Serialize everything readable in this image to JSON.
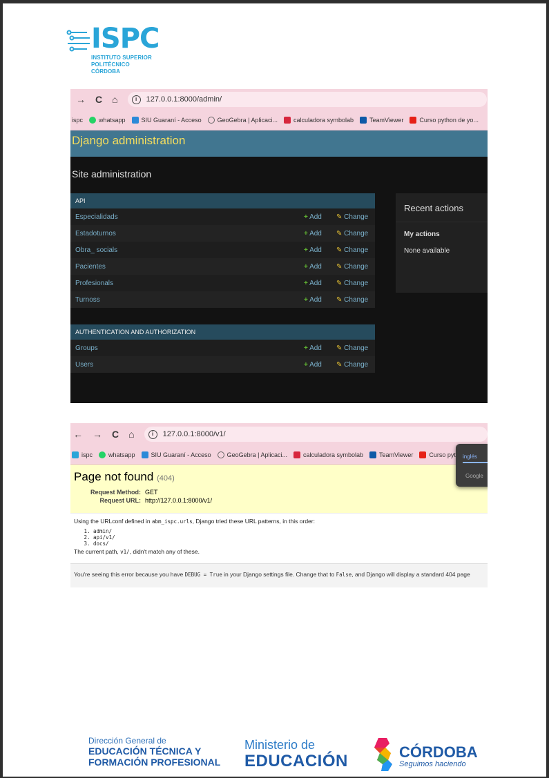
{
  "logo": {
    "name": "ISPC",
    "sub_line1": "INSTITUTO SUPERIOR",
    "sub_line2": "POLITÉCNICO CÓRDOBA"
  },
  "admin_shot": {
    "nav": {
      "back": "←",
      "forward": "→",
      "reload": "C",
      "home": "⌂"
    },
    "url": "127.0.0.1:8000/admin/",
    "bookmarks": [
      "ispc",
      "whatsapp",
      "SIU Guaraní - Acceso",
      "GeoGebra | Aplicaci...",
      "calculadora symbolab",
      "TeamViewer",
      "Curso python de yo..."
    ],
    "header": "Django administration",
    "site_title": "Site administration",
    "api_module": {
      "caption": "API",
      "rows": [
        "Especialidads",
        "Estadoturnos",
        "Obra_ socials",
        "Pacientes",
        "Profesionals",
        "Turnoss"
      ]
    },
    "auth_module": {
      "caption": "AUTHENTICATION AND AUTHORIZATION",
      "rows": [
        "Groups",
        "Users"
      ]
    },
    "add_label": "Add",
    "change_label": "Change",
    "recent": {
      "title": "Recent actions",
      "my_actions": "My actions",
      "none": "None available"
    }
  },
  "error_shot": {
    "url": "127.0.0.1:8000/v1/",
    "bookmarks": [
      "ispc",
      "whatsapp",
      "SIU Guaraní - Acceso",
      "GeoGebra | Aplicaci...",
      "calculadora symbolab",
      "TeamViewer",
      "Curso python de y"
    ],
    "title": "Page not found",
    "code": "(404)",
    "method_label": "Request Method:",
    "method": "GET",
    "url_label": "Request URL:",
    "request_url": "http://127.0.0.1:8000/v1/",
    "info_pre": "Using the URLconf defined in ",
    "urlconf": "abm_ispc.urls",
    "info_post": ", Django tried these URL patterns, in this order:",
    "patterns": [
      "admin/",
      "api/v1/",
      "docs/"
    ],
    "current_pre": "The current path, ",
    "current_path": "v1/",
    "current_post": ", didn't match any of these.",
    "explain_1": "You're seeing this error because you have ",
    "debug_code": "DEBUG = True",
    "explain_2": " in your Django settings file. Change that to ",
    "false_code": "False",
    "explain_3": ", and Django will display a standard 404 page",
    "translate_tab": "inglés",
    "translate_google": "Google"
  },
  "footer": {
    "dg_line1": "Dirección General de",
    "dg_line2": "EDUCACIÓN TÉCNICA Y",
    "dg_line3": "FORMACIÓN PROFESIONAL",
    "min_line1": "Ministerio de",
    "min_line2": "EDUCACIÓN",
    "cba_word": "CÓRDOBA",
    "cba_sub": "Seguimos haciendo"
  },
  "colors": {
    "django_header": "#417690",
    "django_title": "#f5dd5d",
    "module_caption": "#264b5d",
    "link": "#79aec8",
    "add_green": "#5fb132",
    "change_yellow": "#e9c434",
    "error_yellow": "#ffffc8",
    "brand_blue": "#1f5aa6",
    "ispc_blue": "#2aa5d8"
  }
}
